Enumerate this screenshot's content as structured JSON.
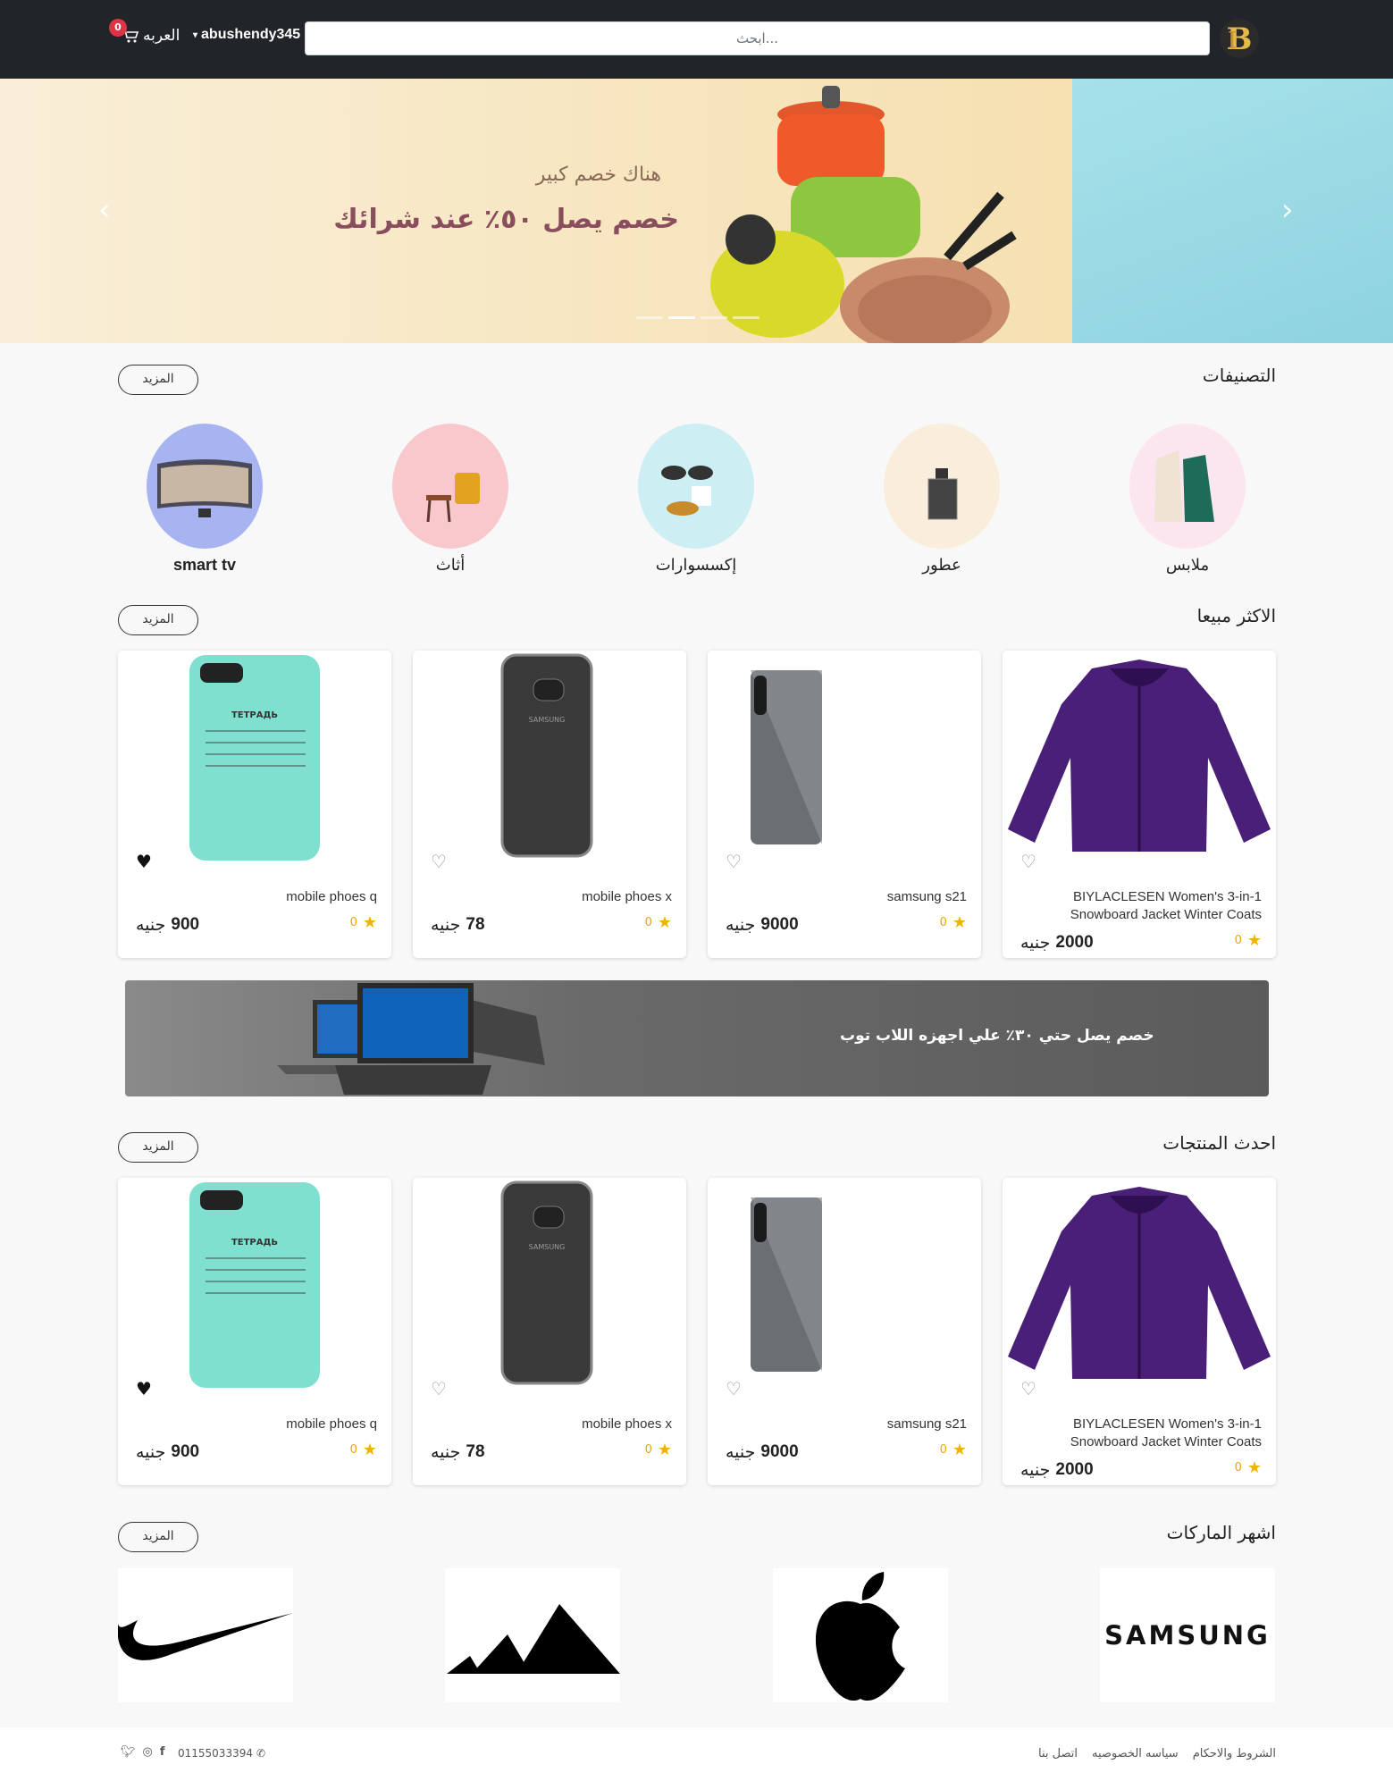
{
  "header": {
    "search_placeholder": "ابحث...",
    "username": "abushendy345",
    "cart_label": "العربه",
    "cart_count": "0"
  },
  "hero": {
    "subtitle": "هناك خصم كبير",
    "title": "خصم يصل ٥٠٪ عند شرائك",
    "slides": 4,
    "active_slide": 2
  },
  "categories": {
    "title": "التصنيفات",
    "more": "المزيد",
    "items": [
      {
        "label": "ملابس",
        "bg": "#fbe6ef"
      },
      {
        "label": "عطور",
        "bg": "#f8eedb"
      },
      {
        "label": "إكسسوارات",
        "bg": "#cdeef2"
      },
      {
        "label": "أثاث",
        "bg": "#f8c8cd"
      },
      {
        "label": "smart tv",
        "bg": "#a8b3f2"
      }
    ]
  },
  "best_sellers": {
    "title": "الاكثر مبيعا",
    "more": "المزيد"
  },
  "products": [
    {
      "name": "BIYLACLESEN Women's 3-in-1 Snowboard Jacket Winter Coats",
      "rating": "0",
      "price": "2000",
      "currency": "جنيه",
      "favorite": false
    },
    {
      "name": "samsung s21",
      "rating": "0",
      "price": "9000",
      "currency": "جنيه",
      "favorite": false
    },
    {
      "name": "mobile phoes x",
      "rating": "0",
      "price": "78",
      "currency": "جنيه",
      "favorite": false
    },
    {
      "name": "mobile phoes q",
      "rating": "0",
      "price": "900",
      "currency": "جنيه",
      "favorite": true
    }
  ],
  "banner": {
    "text": "خصم يصل حتي ٣٠٪ علي اجهزه اللاب توب"
  },
  "latest": {
    "title": "احدث المنتجات",
    "more": "المزيد"
  },
  "brands": {
    "title": "اشهر الماركات",
    "more": "المزيد",
    "items": [
      "SAMSUNG",
      "apple",
      "adidas",
      "nike"
    ]
  },
  "footer": {
    "links": [
      "الشروط والاحكام",
      "سياسه الخصوصيه",
      "اتصل بنا"
    ],
    "phone": "01155033394",
    "social": [
      "twitter-icon",
      "instagram-icon",
      "facebook-icon"
    ]
  },
  "colors": {
    "header_bg": "#212529",
    "badge": "#dc3545",
    "star": "#f0b400",
    "logo_gold": "#e6b94a"
  }
}
